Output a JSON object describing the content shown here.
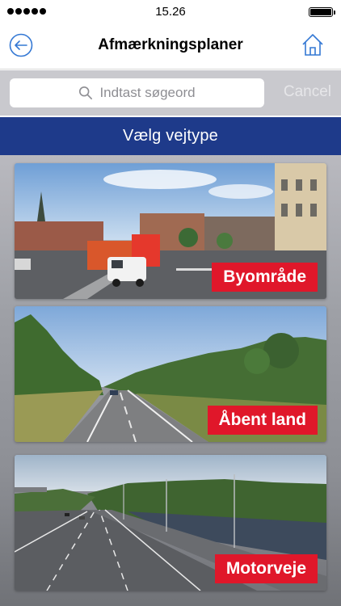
{
  "status_bar": {
    "time": "15.26",
    "signal_icon": "signal-dots-icon",
    "battery_icon": "battery-icon"
  },
  "nav": {
    "title": "Afmærkningsplaner",
    "back_icon": "back-arrow-circle-icon",
    "home_icon": "home-icon"
  },
  "search": {
    "placeholder": "Indtast søgeord",
    "cancel_label": "Cancel",
    "icon": "search-icon"
  },
  "section": {
    "title": "Vælg vejtype"
  },
  "road_types": [
    {
      "label": "Byområde"
    },
    {
      "label": "Åbent land"
    },
    {
      "label": "Motorveje"
    }
  ],
  "colors": {
    "header_blue": "#1e3a8a",
    "label_red": "#e0172a",
    "link_blue": "#3478d4"
  }
}
